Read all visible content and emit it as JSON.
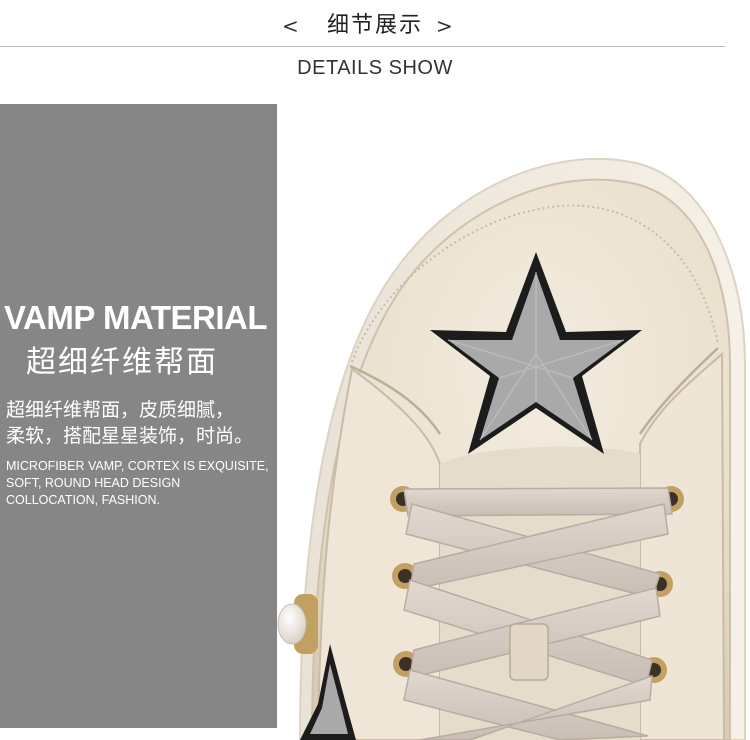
{
  "header": {
    "prev_glyph": "<",
    "next_glyph": ">",
    "title": "细节展示",
    "subtitle": "DETAILS  SHOW"
  },
  "panel": {
    "title": "VAMP MATERIAL",
    "title_cn": "超细纤维帮面",
    "desc_cn": [
      "超细纤维帮面，皮质细腻，",
      "柔软，搭配星星装饰，时尚。"
    ],
    "desc_en": [
      "MICROFIBER VAMP, CORTEX IS EXQUISITE,",
      "SOFT, ROUND HEAD DESIGN",
      "COLLOCATION, FASHION."
    ]
  },
  "colors": {
    "panel_gray": "#868686",
    "shoe_leather": "#ece3d3",
    "lace": "#d8ccc4",
    "star_fill": "#a9a9a9",
    "star_border": "#1c1c1c"
  },
  "icons": {
    "prev": "chevron-left-icon",
    "next": "chevron-right-icon"
  }
}
